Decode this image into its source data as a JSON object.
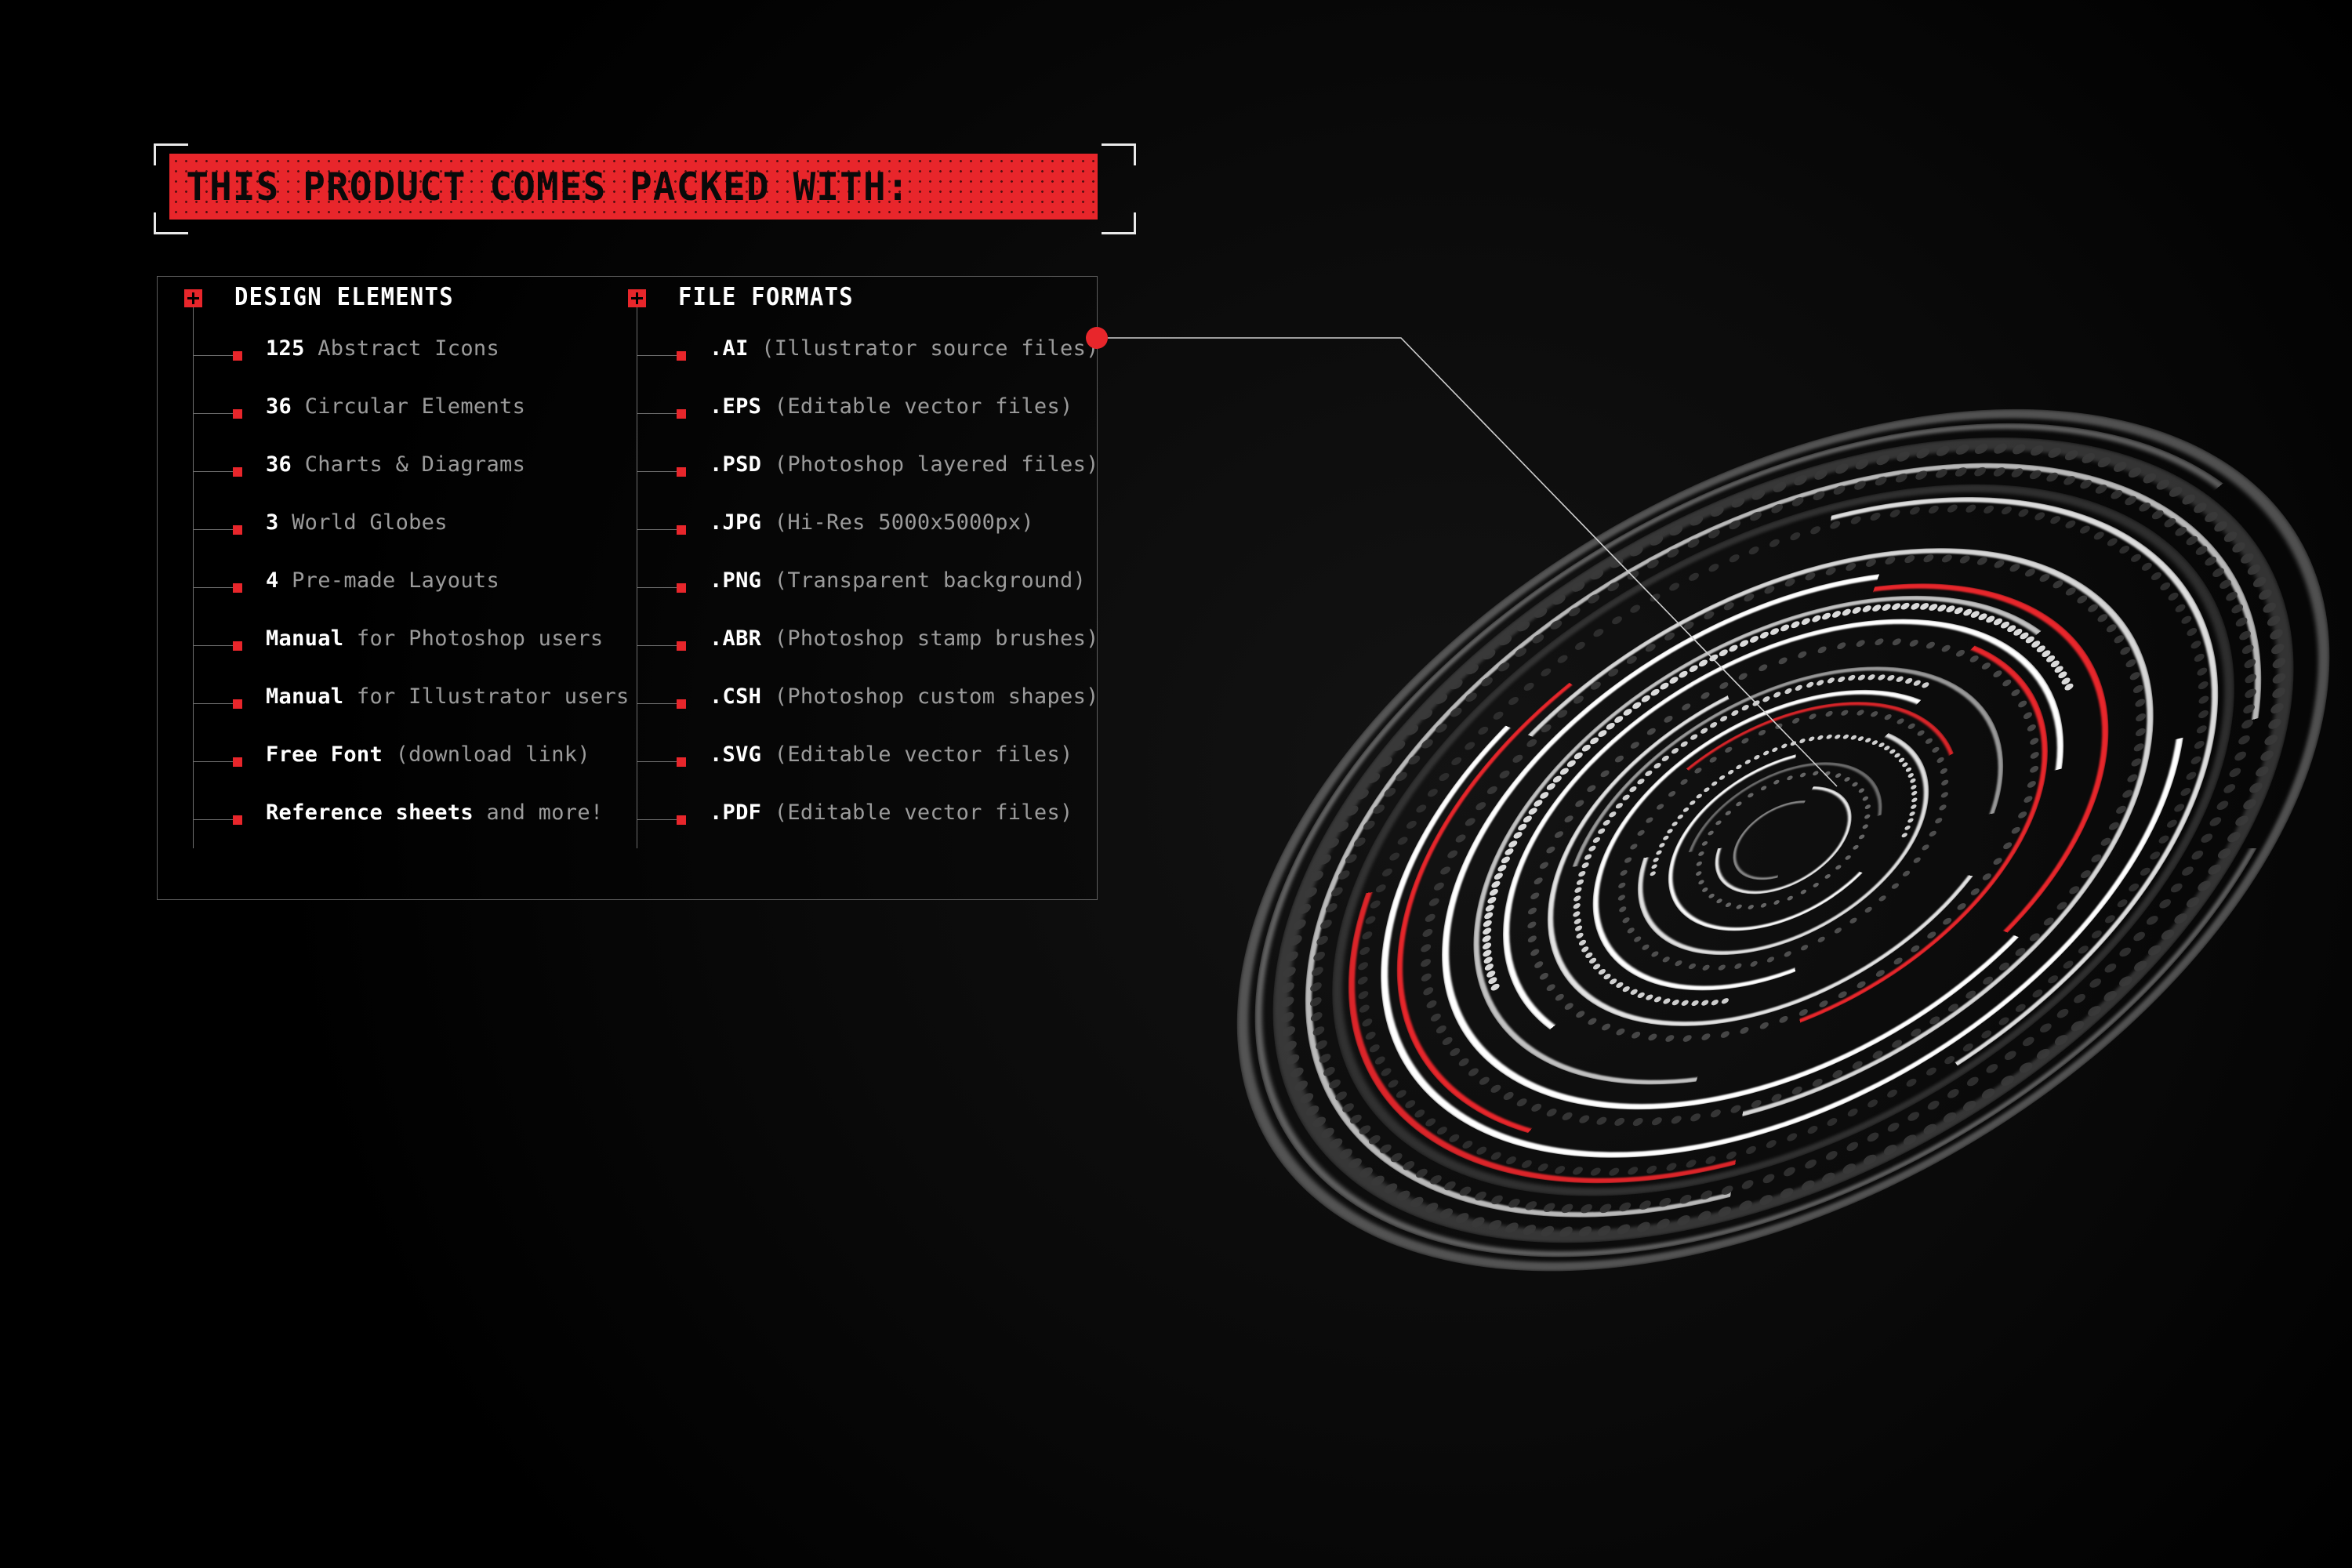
{
  "banner": {
    "title": "THIS PRODUCT COMES PACKED WITH:"
  },
  "colors": {
    "accent_red": "#e8262b",
    "text_white": "#ffffff",
    "text_gray": "#9b9b9b",
    "panel_border": "#5d5d5d",
    "background": "#000000"
  },
  "panel": {
    "columns": [
      {
        "id": "design-elements",
        "title": "DESIGN ELEMENTS",
        "marker_icon": "plus-icon",
        "items": [
          {
            "value": "125",
            "label": "Abstract Icons"
          },
          {
            "value": "36",
            "label": "Circular Elements"
          },
          {
            "value": "36",
            "label": "Charts & Diagrams"
          },
          {
            "value": "3",
            "label": "World Globes"
          },
          {
            "value": "4",
            "label": "Pre-made Layouts"
          },
          {
            "value": "Manual",
            "label": "for Photoshop users"
          },
          {
            "value": "Manual",
            "label": "for Illustrator users"
          },
          {
            "value": "Free Font",
            "label": "(download link)"
          },
          {
            "value": "Reference sheets",
            "label": "and more!"
          }
        ]
      },
      {
        "id": "file-formats",
        "title": "FILE FORMATS",
        "marker_icon": "plus-icon",
        "items": [
          {
            "value": ".AI",
            "label": "(Illustrator source files)"
          },
          {
            "value": ".EPS",
            "label": "(Editable vector files)"
          },
          {
            "value": ".PSD",
            "label": "(Photoshop layered files)"
          },
          {
            "value": ".JPG",
            "label": "(Hi-Res 5000x5000px)"
          },
          {
            "value": ".PNG",
            "label": "(Transparent background)"
          },
          {
            "value": ".ABR",
            "label": "(Photoshop stamp brushes)"
          },
          {
            "value": ".CSH",
            "label": "(Photoshop custom shapes)"
          },
          {
            "value": ".SVG",
            "label": "(Editable vector files)"
          },
          {
            "value": ".PDF",
            "label": "(Editable vector files)"
          }
        ]
      }
    ]
  },
  "callout": {
    "dot_icon": "callout-dot",
    "target": "circular-ring-graphic"
  },
  "graphic": {
    "name": "concentric-ring-infographic",
    "description": "Tilted 3D perspective of concentric dashed rings in white, red and gray"
  }
}
